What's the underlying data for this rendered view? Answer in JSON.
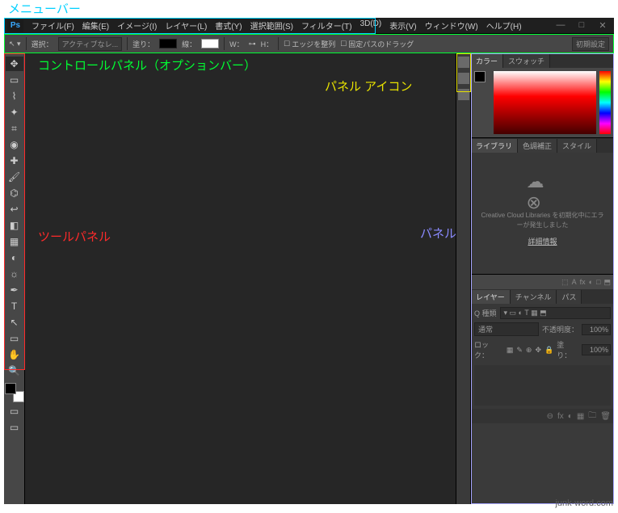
{
  "annotations": {
    "menu_bar": "メニューバー",
    "control_panel": "コントロールパネル（オプションバー）",
    "panel_icons": "パネル アイコン",
    "tool_panel": "ツールパネル",
    "panel": "パネル",
    "colors": {
      "menu_bar": "#00d0ff",
      "control_panel": "#00ff33",
      "panel_icons": "#e8e200",
      "tool_panel": "#ff2a2a",
      "panel": "#8a8aff"
    }
  },
  "app_badge": "Ps",
  "menu": [
    "ファイル(F)",
    "編集(E)",
    "イメージ(I)",
    "レイヤー(L)",
    "書式(Y)",
    "選択範囲(S)",
    "フィルター(T)",
    "3D(D)",
    "表示(V)",
    "ウィンドウ(W)",
    "ヘルプ(H)"
  ],
  "window_controls": {
    "min": "—",
    "max": "□",
    "close": "✕"
  },
  "option_bar": {
    "select_label": "選択：",
    "active_layer": "アクティブなレ...",
    "fill_label": "塗り：",
    "stroke_label": "線：",
    "w_label": "W：",
    "h_label": "H：",
    "edge_align": "エッジを整列",
    "fixed_path": "固定パスのドラッグ",
    "preset": "初期設定"
  },
  "tools": [
    "move",
    "marquee",
    "lasso",
    "wand",
    "crop",
    "eyedropper",
    "heal",
    "brush",
    "stamp",
    "history",
    "eraser",
    "gradient",
    "blur",
    "dodge",
    "pen",
    "text",
    "path",
    "shape",
    "hand",
    "zoom"
  ],
  "tool_glyphs": [
    "✥",
    "▭",
    "⌇",
    "✦",
    "⌗",
    "◉",
    "✚",
    "🖌",
    "⌬",
    "↩",
    "◧",
    "▦",
    "◐",
    "☼",
    "✒",
    "T",
    "↖",
    "▭",
    "✋",
    "🔍"
  ],
  "panel_icon_strip": [
    "adjustments",
    "properties",
    "histogram"
  ],
  "right": {
    "color_tabs": [
      "カラー",
      "スウォッチ"
    ],
    "lib_tabs": [
      "ライブラリ",
      "色調補正",
      "スタイル"
    ],
    "lib_message_1": "Creative Cloud Libraries を初期化中にエラ",
    "lib_message_2": "ーが発生しました",
    "lib_link": "詳細情報",
    "layer_tool_icons": [
      "⬚",
      "A",
      "fx",
      "◐",
      "□",
      "⬒"
    ],
    "layer_tabs": [
      "レイヤー",
      "チャンネル",
      "パス"
    ],
    "kind_label": "Q 種類",
    "mode_label": "通常",
    "opacity_label": "不透明度：",
    "opacity_value": "100%",
    "lock_label": "ロック：",
    "fill_label": "塗り：",
    "fill_value": "100%",
    "lock_icons": [
      "▦",
      "✎",
      "⊕",
      "✥",
      "🔒"
    ],
    "foot_icons": [
      "⊖",
      "fx",
      "◐",
      "▦",
      "🗀",
      "🗑"
    ]
  },
  "watermark": "junk-word.com"
}
